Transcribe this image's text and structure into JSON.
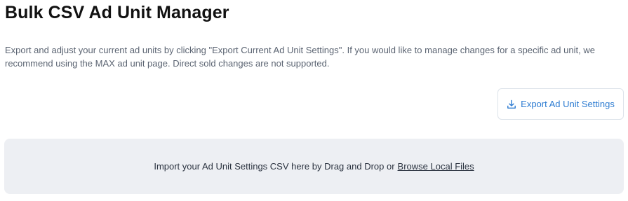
{
  "page": {
    "title": "Bulk CSV Ad Unit Manager",
    "description": "Export and adjust your current ad units by clicking \"Export Current Ad Unit Settings\". If you would like to manage changes for a specific ad unit, we recommend using the MAX ad unit page. Direct sold changes are not supported."
  },
  "export_button": {
    "label": "Export Ad Unit Settings",
    "icon": "download-icon",
    "color": "#2c7bd1"
  },
  "dropzone": {
    "text": "Import your Ad Unit Settings CSV here by Drag and Drop or",
    "link_label": "Browse Local Files",
    "background": "#edeff3"
  }
}
